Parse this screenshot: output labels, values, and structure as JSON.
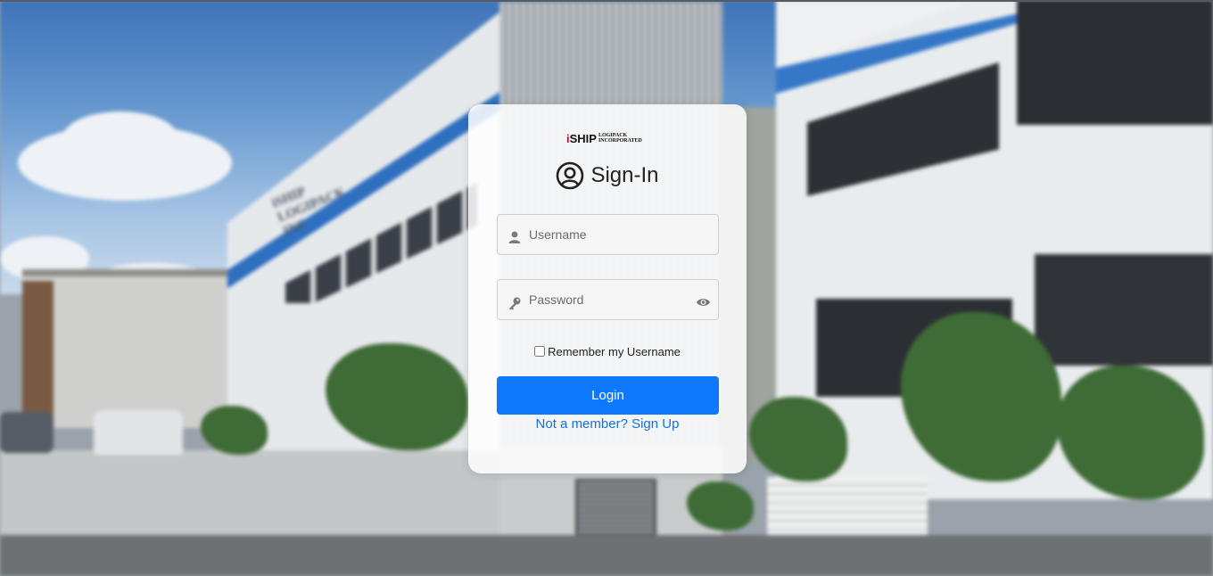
{
  "logo": {
    "brand_i": "i",
    "brand_ship": "SHIP",
    "brand_line1": "LOGIPACK",
    "brand_line2": "INCORPORATED"
  },
  "background": {
    "building_sign": "iSHIP LOGIPACK INC"
  },
  "form": {
    "title": "Sign-In",
    "title_icon": "user-circle-icon",
    "username_placeholder": "Username",
    "username_value": "",
    "username_icon": "user-icon",
    "password_placeholder": "Password",
    "password_value": "",
    "password_icon": "key-icon",
    "toggle_icon": "eye-icon",
    "remember_label": "Remember my Username",
    "remember_checked": false,
    "login_label": "Login",
    "signup_text": "Not a member? Sign Up"
  },
  "colors": {
    "primary_button": "#0d78fb",
    "link": "#1570d9",
    "logo_accent": "#c8102e"
  }
}
